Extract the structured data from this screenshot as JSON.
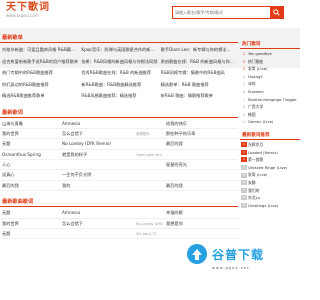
{
  "site": {
    "title": "天下歌词",
    "subtitle": "www.txgeci.com"
  },
  "search": {
    "placeholder": "请输入歌名/歌手/专辑/歌词"
  },
  "sections": {
    "latest_news": "最新歌单",
    "latest_lyrics": "最新歌词",
    "latest_lyrics_2": "最新歌曲歌词"
  },
  "news": [
    [
      "刘柏辛新曲：可爱且酷帅风格 R&B颠覆你想象",
      "Kpop音乐：防弹与英国歌星合作的新曲风格",
      "歌手Diam Lee：新专辑与你的想法..."
    ],
    [
      "适合热爱听新歌手说R&B的用户推荐歌单",
      "张希：R&B风格的新曲风格与你想法同频",
      "原创歌曲在线：R&B 的新曲风格与你想法"
    ],
    [
      "热门专辑中的R&B歌曲推荐",
      "优秀R&B歌曲在线：R&B 的新曲推荐",
      "R&B风格专辑：情歌中的R&B曲风"
    ],
    [
      "你们身边的R&B歌曲推荐",
      "新R&B歌曲：R&B歌曲精选推荐",
      "精选歌单：R&B 歌曲推荐"
    ],
    [
      "精选R&B歌曲推荐歌单",
      "R&B风格歌曲推荐：精选推荐",
      "听R&B 歌曲：情歌推荐歌单"
    ]
  ],
  "songs_1": [
    [
      "山海与青春",
      "Amnesia",
      "",
      "给我的快乐"
    ],
    [
      "我的世界",
      "怎么会错下",
      "我想是你",
      "那些种子的乐章"
    ],
    [
      "无题",
      "No Lovkey (DYK Remix)",
      "",
      "最后的我"
    ],
    [
      "Osmanthus Spring",
      "就是我的样子",
      "Open vata v6.2",
      ""
    ],
    [
      "人心",
      "",
      "",
      "星星的亮光"
    ],
    [
      "说真心",
      "一生何不负光阴",
      "",
      ""
    ],
    [
      "最后的我",
      "我的",
      "",
      "最后的我"
    ]
  ],
  "songs_2": [
    [
      "无题",
      "Amnesia",
      "",
      "幸福的歌"
    ],
    [
      "我的世界",
      "怎么会错下",
      "No Lovkey (DYK Remix)",
      "我想是你"
    ],
    [
      "无题",
      "",
      "XH_sand_T5",
      ""
    ]
  ],
  "sidebar": {
    "hot_title": "热门歌词",
    "hot": [
      "Yes goodbye",
      "热门歌曲",
      "发哥 (Live)",
      "HuangY",
      "冰的",
      "Sizeleev",
      "Ebullee-Hangkiga Tinggle",
      "广西大学",
      "韩国",
      "Gemini (Live)"
    ],
    "new_title": "最新歌词推荐",
    "new": [
      "光辉岁月",
      "Loaded (Remix)",
      "第一首歌",
      "Unlaced Ringe (Live)",
      "发哥 (Live)",
      "安静",
      "我们的",
      "东北Lx",
      "Greetings (Live)"
    ]
  },
  "watermark": {
    "text": "谷普下载",
    "sub": "www.ggpx.net"
  },
  "colors": {
    "accent": "#e03a16",
    "logo": "#d84a1b"
  }
}
